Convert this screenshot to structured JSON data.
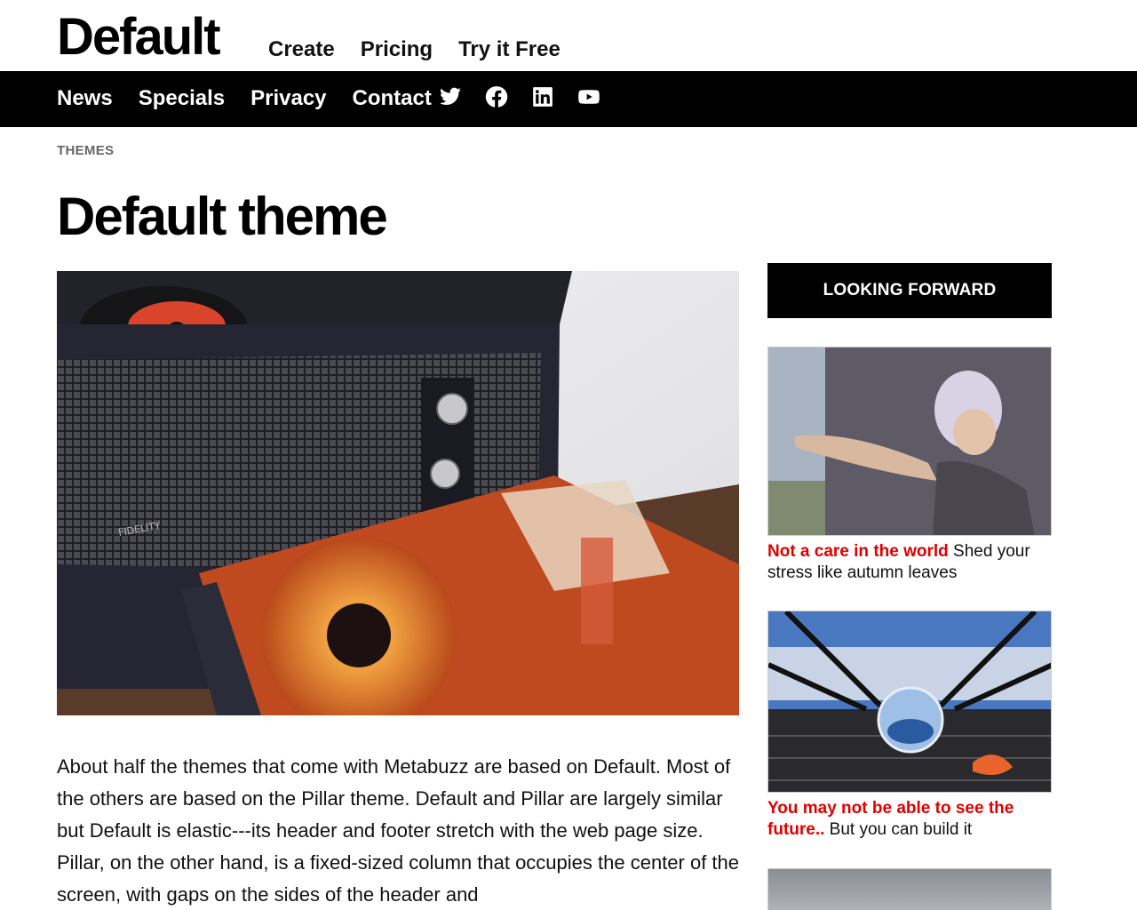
{
  "header": {
    "logo": "Default",
    "top_nav": [
      "Create",
      "Pricing",
      "Try it Free"
    ]
  },
  "nav": {
    "items": [
      "News",
      "Specials",
      "Privacy",
      "Contact"
    ],
    "social_icons": [
      "twitter-icon",
      "facebook-icon",
      "linkedin-icon",
      "youtube-icon"
    ]
  },
  "breadcrumb": "THEMES",
  "page_title": "Default theme",
  "hero_image": "record-player-with-vinyl-albums",
  "article": {
    "body": "About half the themes that come with Metabuzz are based on Default. Most of the others are based on the Pillar theme. Default and Pillar are largely similar but Default is elastic---its header and footer stretch with the web page size. Pillar, on the other hand, is a fixed-sized column that occupies the center of the screen, with gaps on the sides of the header and"
  },
  "sidebar": {
    "header": "LOOKING FORWARD",
    "cards": [
      {
        "highlight": "Not a care in the world",
        "text": " Shed your stress like autumn leaves",
        "image": "tattooed-woman-reaching-out"
      },
      {
        "highlight": "You may not be able to see the future..",
        "text": " But you can build it",
        "image": "crystal-ball-on-bridge"
      },
      {
        "highlight": "",
        "text": "",
        "image": "gray-texture"
      }
    ]
  },
  "colors": {
    "accent": "#e00000",
    "nav_bg": "#000000",
    "breadcrumb": "#666666"
  }
}
